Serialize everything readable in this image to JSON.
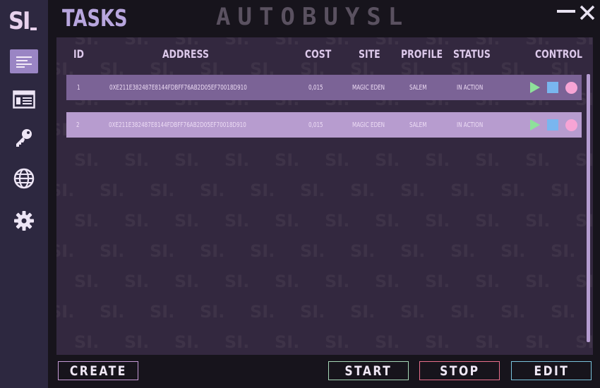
{
  "app": {
    "logo_text": "SI",
    "page_title": "TASKS",
    "brand": "AUTOBUYSL",
    "watermark_text": "SI."
  },
  "sidebar": {
    "items": [
      {
        "icon": "tasks-list-icon",
        "active": true
      },
      {
        "icon": "profiles-card-icon",
        "active": false
      },
      {
        "icon": "key-icon",
        "active": false
      },
      {
        "icon": "globe-icon",
        "active": false
      },
      {
        "icon": "gear-icon",
        "active": false
      }
    ]
  },
  "table": {
    "columns": {
      "id": "ID",
      "address": "ADDRESS",
      "cost": "COST",
      "site": "SITE",
      "profile": "PROFILE",
      "status": "STATUS",
      "control": "CONTROL"
    },
    "rows": [
      {
        "id": "1",
        "address": "0XE211E382487E8144FDBFF76AB2D05EF70018D910",
        "cost": "0,015",
        "site": "MAGIC EDEN",
        "profile": "SALEM",
        "status": "IN ACTION"
      },
      {
        "id": "2",
        "address": "0XE211E382487E8144FDBFF76AB2D05EF70018D910",
        "cost": "0,015",
        "site": "MAGIC EDEN",
        "profile": "SALEM",
        "status": "IN ACTION"
      }
    ]
  },
  "buttons": {
    "create": "CREATE",
    "start": "START",
    "stop": "STOP",
    "edit": "EDIT"
  },
  "colors": {
    "sidebar_bg": "#2d2840",
    "panel_bg": "#33283f",
    "row1_bg": "#7b6396",
    "row2_bg": "#b79ccf",
    "play": "#8ee09a",
    "stop": "#79b6ef",
    "record": "#f7a4d5"
  }
}
